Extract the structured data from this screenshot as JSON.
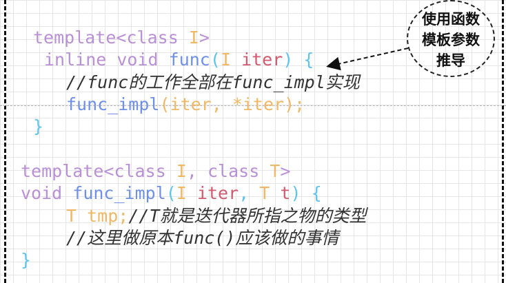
{
  "code": {
    "line1": {
      "kw1": "template",
      "lt": "<",
      "kw2": "class",
      "sp": " ",
      "t": "I",
      "gt": ">"
    },
    "line2": {
      "kw1": "inline",
      "kw2": "void",
      "fn": "func",
      "po": "(",
      "t": "I",
      "v": "iter",
      "pc": ")",
      "br": "{"
    },
    "line3": {
      "comment": "//func的工作全部在func_impl实现"
    },
    "line4": {
      "fn": "func_impl",
      "args": "(iter, *iter);"
    },
    "line5": {
      "br": "}"
    },
    "line6": {
      "kw1": "template",
      "lt": "<",
      "kw2": "class",
      "t1": "I",
      "comma": ",",
      "kw3": "class",
      "t2": "T",
      "gt": ">"
    },
    "line7": {
      "kw": "void",
      "fn": "func_impl",
      "po": "(",
      "t1": "I",
      "v1": "iter",
      "comma": ",",
      "t2": "T",
      "v2": "t",
      "pc": ")",
      "br": "{"
    },
    "line8": {
      "t": "T",
      "v": "tmp;",
      "comment": "//T就是迭代器所指之物的类型"
    },
    "line9": {
      "comment": "//这里做原本func()应该做的事情"
    },
    "line10": {
      "br": "}"
    }
  },
  "callout": {
    "line1": "使用函数",
    "line2": "模板参数",
    "line3": "推导"
  }
}
